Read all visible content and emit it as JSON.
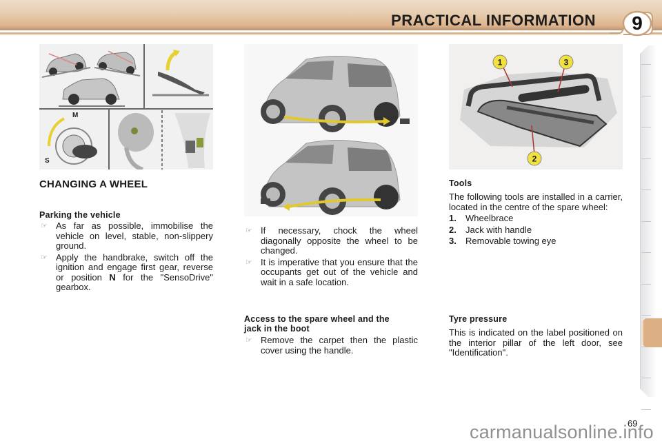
{
  "header": {
    "title": "PRACTICAL INFORMATION",
    "chapter_number": "9",
    "accent_color": "#ddb48c"
  },
  "sidebar_tabs": {
    "count": 12,
    "active_index": 10,
    "active_color": "#dcb084"
  },
  "figures": {
    "parking": {
      "description": "Parking the vehicle illustrations: cars on slope, handbrake, ignition switch positions M and S, gear lever",
      "labels": [
        "M",
        "S"
      ]
    },
    "chocking": {
      "description": "Two cars showing wheel chock placed diagonally opposite the wheel to be changed"
    },
    "tools": {
      "description": "Tool carrier with wheelbrace, jack with handle and towing eye",
      "callouts": [
        "1",
        "2",
        "3"
      ]
    }
  },
  "column1": {
    "section_title": "CHANGING A WHEEL",
    "subheading": "Parking the vehicle",
    "bullets": [
      "As far as possible, immobilise the vehicle on level, stable, non-slippery ground.",
      {
        "before": "Apply the handbrake, switch off the ignition and engage first gear, reverse or position ",
        "bold": "N",
        "after": " for the \"SensoDrive\" gearbox."
      }
    ],
    "bullet_icon": "pointing-hand-icon"
  },
  "column2": {
    "bullets": [
      "If necessary, chock the wheel diagonally opposite the wheel to be changed.",
      "It is imperative that you ensure that the occupants get out of the vehicle and wait in a safe location."
    ],
    "subheading": "Access to the spare wheel and the jack in the boot",
    "bullets2": [
      "Remove the carpet then the plastic cover using the handle."
    ]
  },
  "column3": {
    "tools_heading": "Tools",
    "tools_intro": "The following tools are installed in a carrier, located in the centre of the spare wheel:",
    "tools_list": [
      {
        "num": "1.",
        "label": "Wheelbrace"
      },
      {
        "num": "2.",
        "label": "Jack with handle"
      },
      {
        "num": "3.",
        "label": "Removable towing eye"
      }
    ],
    "tyre_heading": "Tyre pressure",
    "tyre_text": "This is indicated on the label positioned on the interior pillar of the left door, see \"Identification\"."
  },
  "footer": {
    "page_number": "69",
    "watermark": "carmanualsonline.info"
  }
}
